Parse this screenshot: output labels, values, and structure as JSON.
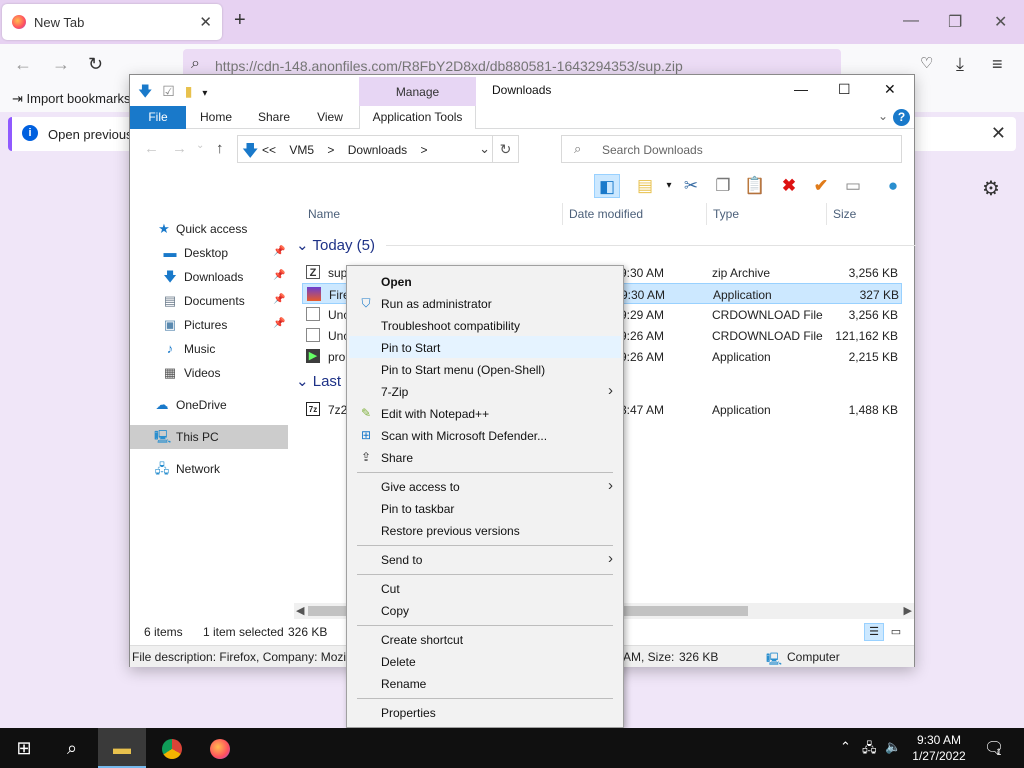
{
  "firefox": {
    "tab_title": "New Tab",
    "tab_close": "✕",
    "new_tab": "+",
    "url": "https://cdn-148.anonfiles.com/R8FbY2D8xd/db880581-1643294353/sup.zip",
    "bookmarks_item": "Import bookmarks...",
    "notification": "Open previous t",
    "accent": "#9059ff"
  },
  "explorer": {
    "manage_tab": "Manage",
    "window_title": "Downloads",
    "ribbon_tabs": [
      "File",
      "Home",
      "Share",
      "View",
      "Application Tools"
    ],
    "breadcrumb": [
      "<<",
      "VM5",
      ">",
      "Downloads",
      ">"
    ],
    "search_placeholder": "Search Downloads",
    "nav": {
      "quick_access": "Quick access",
      "desktop": "Desktop",
      "downloads": "Downloads",
      "documents": "Documents",
      "pictures": "Pictures",
      "music": "Music",
      "videos": "Videos",
      "onedrive": "OneDrive",
      "this_pc": "This PC",
      "network": "Network"
    },
    "columns": {
      "name": "Name",
      "date": "Date modified",
      "type": "Type",
      "size": "Size"
    },
    "groups": {
      "today": "Today (5)",
      "last": "Last n"
    },
    "rows": [
      {
        "name": "sup",
        "date": "9:30 AM",
        "type": "zip Archive",
        "size": "3,256 KB"
      },
      {
        "name": "Fire",
        "date": "9:30 AM",
        "type": "Application",
        "size": "327 KB"
      },
      {
        "name": "Unc",
        "date": "9:29 AM",
        "type": "CRDOWNLOAD File",
        "size": "3,256 KB"
      },
      {
        "name": "Unc",
        "date": "9:26 AM",
        "type": "CRDOWNLOAD File",
        "size": "121,162 KB"
      },
      {
        "name": "pro",
        "date": "9:26 AM",
        "type": "Application",
        "size": "2,215 KB"
      },
      {
        "name": "7z2",
        "date": "3:47 AM",
        "type": "Application",
        "size": "1,488 KB"
      }
    ],
    "status": {
      "items": "6 items",
      "selected": "1 item selected",
      "sel_size": "326 KB"
    },
    "info": {
      "desc": "File description: Firefox, Company: Mozil",
      "size": "AM, Size:",
      "size_val": "326 KB",
      "computer": "Computer"
    }
  },
  "context_menu": {
    "open": "Open",
    "run_admin": "Run as administrator",
    "troubleshoot": "Troubleshoot compatibility",
    "pin_start": "Pin to Start",
    "pin_start_menu": "Pin to Start menu (Open-Shell)",
    "seven_zip": "7-Zip",
    "notepad": "Edit with Notepad++",
    "defender": "Scan with Microsoft Defender...",
    "share": "Share",
    "give_access": "Give access to",
    "pin_taskbar": "Pin to taskbar",
    "restore": "Restore previous versions",
    "send_to": "Send to",
    "cut": "Cut",
    "copy": "Copy",
    "create_shortcut": "Create shortcut",
    "delete": "Delete",
    "rename": "Rename",
    "properties": "Properties"
  },
  "taskbar": {
    "time": "9:30 AM",
    "date": "1/27/2022",
    "notification_count": "1"
  }
}
